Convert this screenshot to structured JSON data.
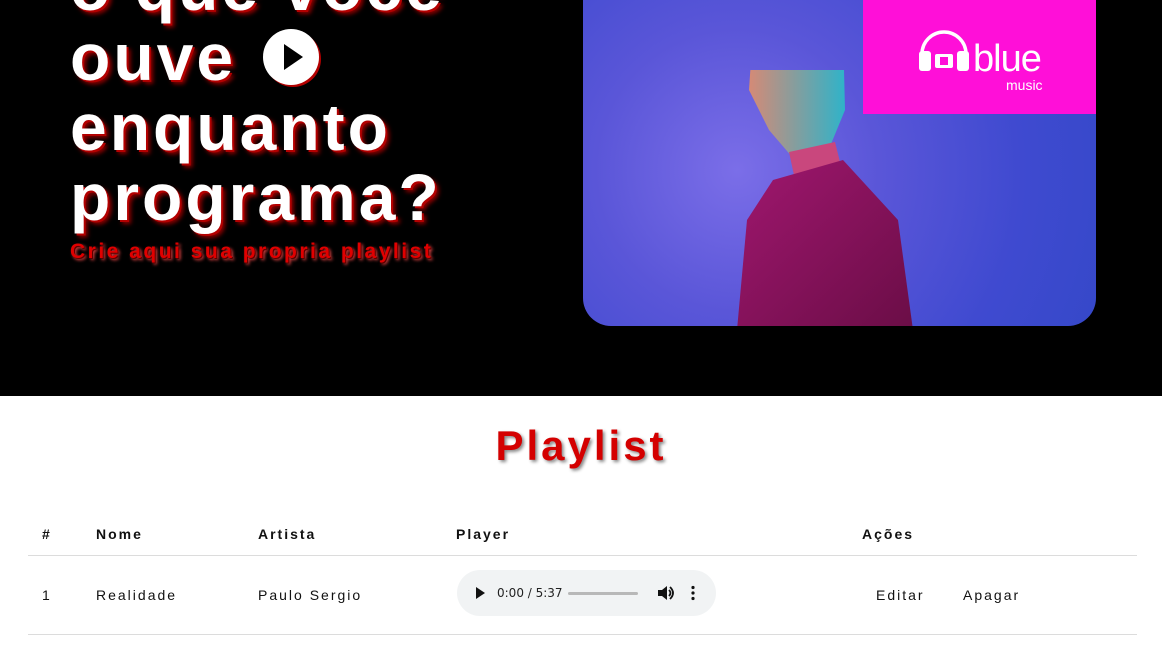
{
  "hero": {
    "title_lines": [
      "o que você",
      "ouve",
      "enquanto",
      "programa?"
    ],
    "subtitle": "Crie aqui sua propria playlist",
    "logo_word": "blue",
    "logo_sub": "music"
  },
  "playlist": {
    "title": "Playlist",
    "columns": [
      "#",
      "Nome",
      "Artista",
      "Player",
      "Ações"
    ],
    "rows": [
      {
        "index": "1",
        "name": "Realidade",
        "artist": "Paulo Sergio",
        "player_time": "0:00 / 5:37",
        "edit_label": "Editar",
        "delete_label": "Apagar"
      }
    ]
  }
}
